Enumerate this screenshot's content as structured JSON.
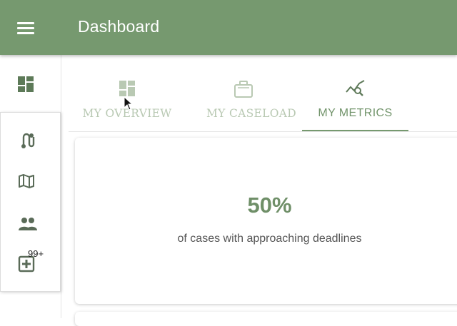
{
  "app_bar": {
    "title": "Dashboard",
    "menu_icon": "hamburger-menu-icon",
    "color": "#76996f"
  },
  "nav_rail": {
    "items": [
      {
        "name": "dashboard",
        "icon": "dashboard-grid-icon"
      },
      {
        "name": "routes",
        "icon": "route-icon"
      },
      {
        "name": "map",
        "icon": "map-icon"
      },
      {
        "name": "people",
        "icon": "people-icon"
      },
      {
        "name": "new-case",
        "icon": "add-box-icon",
        "badge": "99+"
      }
    ]
  },
  "tabs": [
    {
      "label": "MY OVERVIEW",
      "icon": "dashboard-grid-icon",
      "active": false
    },
    {
      "label": "MY CASELOAD",
      "icon": "briefcase-icon",
      "active": false
    },
    {
      "label": "MY METRICS",
      "icon": "insights-chart-icon",
      "active": true
    }
  ],
  "metric_card": {
    "value": "50%",
    "caption": "of cases with approaching deadlines"
  },
  "colors": {
    "accent": "#76996f",
    "tab_inactive": "#b9c9b3",
    "metric_value": "#6f8f68",
    "icon": "#5a6b58"
  }
}
